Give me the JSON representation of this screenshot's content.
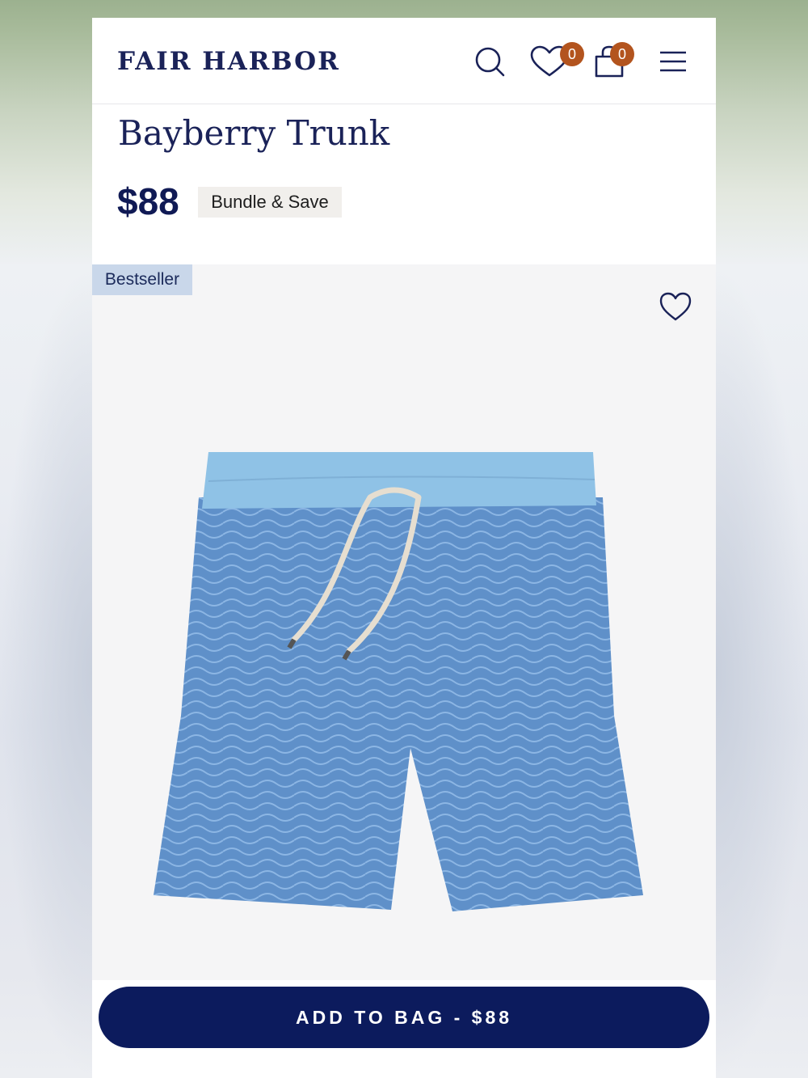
{
  "header": {
    "brand": "FAIR HARBOR",
    "wishlist_count": "0",
    "cart_count": "0",
    "icons": [
      "search-icon",
      "heart-icon",
      "shopping-bag-icon",
      "hamburger-menu-icon"
    ]
  },
  "product": {
    "title": "Bayberry Trunk",
    "price": "$88",
    "bundle_label": "Bundle & Save",
    "badge": "Bestseller",
    "image_icon": "swim-trunk-image"
  },
  "cta": {
    "label": "ADD TO BAG - $88"
  },
  "colors": {
    "brand_navy": "#101a55",
    "cta_navy": "#0c1b5d",
    "badge_orange": "#b3541e",
    "bestseller_bg": "#c9d7ea",
    "trunk_blue": "#6f9ed3"
  }
}
